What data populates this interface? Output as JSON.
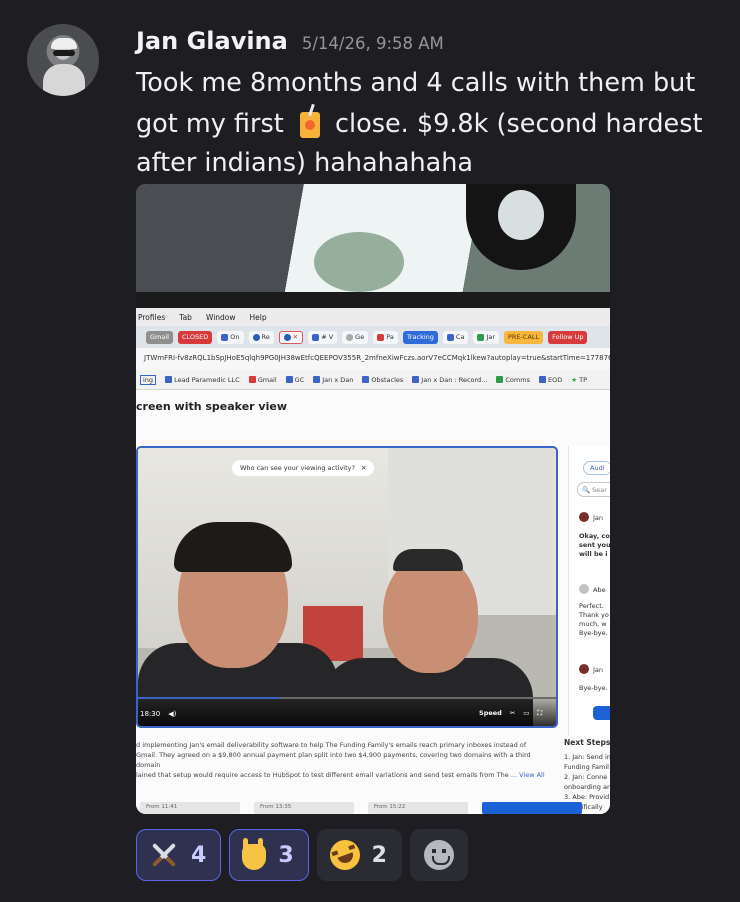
{
  "message": {
    "username": "Jan Glavina",
    "timestamp": "5/14/26, 9:58 AM",
    "text_part1": "Took me 8months and 4 calls with them but got my first",
    "text_part2": "close. $9.8k (second hardest after indians) hahahahaha",
    "inline_emoji": "juice-box-emoji"
  },
  "attachment": {
    "menu": [
      "Profiles",
      "Tab",
      "Window",
      "Help"
    ],
    "tabs": [
      "Gmail",
      "CLOSED",
      "On",
      "Re",
      "",
      "# V",
      "Ge",
      "Pa",
      "Tracking",
      "Ca",
      "Jar",
      "PRE-CALL",
      "Follow Up"
    ],
    "url": "JTWmFRI-fv8zRQL1bSpJHoE5qlqh9PG0JH38wEtfcQEEPOV355R_2mfneXiwFczs.aorV7eCCMqk1lkew?autoplay=true&startTime=177876",
    "bookmarks": [
      "ing",
      "Lead Paramedic LLC",
      "Gmail",
      "GC",
      "Jan x Dan",
      "Obstacles",
      "Jan x Dan : Record...",
      "Comms",
      "EOD",
      "TP"
    ],
    "page_title": "creen with speaker view",
    "viewing_prompt": "Who can see your viewing activity?",
    "video_time": "18:30",
    "video_progress": 0.34,
    "speed_label": "Speed",
    "side_tab": "Audi",
    "side_search": "Sear",
    "side_messages": [
      {
        "name": "Jan",
        "text": ""
      },
      {
        "name": "",
        "text": "Okay, co sent you will be i"
      },
      {
        "name": "Abe",
        "text": "Perfect. Thank yo much, w Bye-bye."
      },
      {
        "name": "Jan",
        "text": "Bye-bye."
      }
    ],
    "summary_line1": "d implementing Jan's email deliverability software to help The Funding Family's emails reach primary inboxes instead of",
    "summary_line2": "Gmail. They agreed on a $9,800 annual payment plan split into two $4,900 payments, covering two domains with a third domain",
    "summary_line3": "lained that setup would require access to HubSpot to test different email variations and send test emails from The",
    "summary_link": "... View All",
    "next_steps_title": "Next Steps",
    "next_steps": [
      "1. Jan: Send in Funding Famil",
      "2. Jan: Conne onboarding ar",
      "3. Abe: Provid (specifically"
    ],
    "thumb_labels": [
      "From 11:41",
      "From 13:35",
      "From 15:22",
      ""
    ]
  },
  "reactions": [
    {
      "emoji": "crossed-swords-emoji",
      "count": "4",
      "mine": true
    },
    {
      "emoji": "sign-of-horns-emoji",
      "count": "3",
      "mine": true
    },
    {
      "emoji": "rolling-laughing-emoji",
      "count": "2",
      "mine": false
    }
  ],
  "colors": {
    "background": "#1e1e22",
    "accent": "#5a65ea",
    "username": "#f2f3f5",
    "timestamp": "#94959c"
  }
}
